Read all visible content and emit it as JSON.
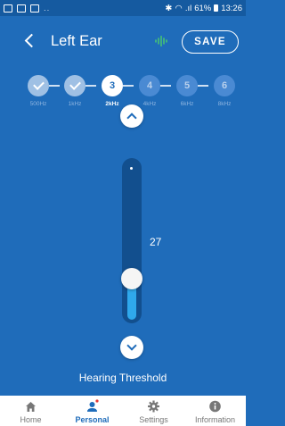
{
  "status_bar": {
    "signal_text": "..",
    "battery": "61%",
    "time": "13:26"
  },
  "header": {
    "title": "Left Ear",
    "save_label": "SAVE"
  },
  "steps": [
    {
      "number": "",
      "label": "500Hz",
      "state": "done"
    },
    {
      "number": "",
      "label": "1kHz",
      "state": "done"
    },
    {
      "number": "3",
      "label": "2kHz",
      "state": "current"
    },
    {
      "number": "4",
      "label": "4kHz",
      "state": "todo"
    },
    {
      "number": "5",
      "label": "6kHz",
      "state": "todo"
    },
    {
      "number": "6",
      "label": "8kHz",
      "state": "todo"
    }
  ],
  "slider": {
    "value": "27",
    "level_fraction": 0.27,
    "label": "Hearing Threshold"
  },
  "nav": [
    {
      "label": "Home",
      "icon": "home-icon",
      "active": false
    },
    {
      "label": "Personal",
      "icon": "person-icon",
      "active": true
    },
    {
      "label": "Settings",
      "icon": "gear-icon",
      "active": false
    },
    {
      "label": "Information",
      "icon": "info-icon",
      "active": false
    }
  ],
  "colors": {
    "primary": "#1f6cba",
    "track": "#124f8e",
    "fill": "#2fa8ec",
    "wave": "#4ccf6a"
  }
}
